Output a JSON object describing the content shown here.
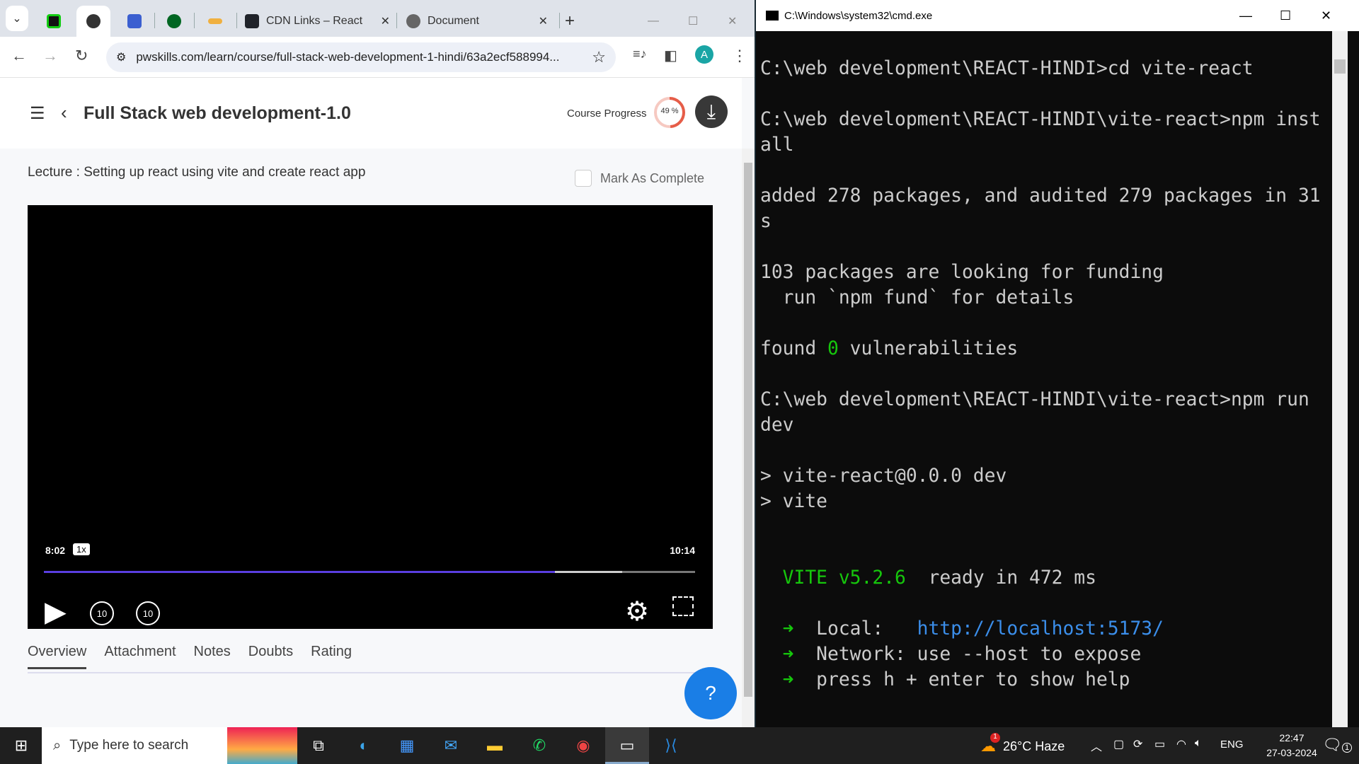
{
  "browser": {
    "tabs": [
      {
        "label": "CDN Links – React"
      },
      {
        "label": "Document"
      }
    ],
    "url": "pwskills.com/learn/course/full-stack-web-development-1-hindi/63a2ecf588994...",
    "profile_initial": "A"
  },
  "page": {
    "course_title": "Full Stack web development-1.0",
    "progress_label": "Course Progress",
    "progress_value": "49 %",
    "progress_fraction": 0.49,
    "lecture_title": "Lecture : Setting up react using vite and create react app",
    "mark_complete": "Mark As Complete",
    "video": {
      "current_time": "8:02",
      "speed": "1x",
      "duration": "10:14",
      "played_fraction": 0.785,
      "buffered_fraction": 0.888,
      "rewind_label": "10",
      "forward_label": "10"
    },
    "tabs": [
      {
        "label": "Overview",
        "active": true
      },
      {
        "label": "Attachment"
      },
      {
        "label": "Notes"
      },
      {
        "label": "Doubts"
      },
      {
        "label": "Rating"
      }
    ],
    "accent": "#5a3ee0"
  },
  "cmd": {
    "title": "C:\\Windows\\system32\\cmd.exe",
    "lines": [
      [
        {
          "t": "C:\\web development\\REACT-HINDI>cd vite-react"
        }
      ],
      [],
      [
        {
          "t": "C:\\web development\\REACT-HINDI\\vite-react>npm inst"
        }
      ],
      [
        {
          "t": "all"
        }
      ],
      [],
      [
        {
          "t": "added 278 packages, and audited 279 packages in 31"
        }
      ],
      [
        {
          "t": "s"
        }
      ],
      [],
      [
        {
          "t": "103 packages are looking for funding"
        }
      ],
      [
        {
          "t": "  run `npm fund` for details"
        }
      ],
      [],
      [
        {
          "t": "found "
        },
        {
          "t": "0",
          "c": "#16c60c"
        },
        {
          "t": " vulnerabilities"
        }
      ],
      [],
      [
        {
          "t": "C:\\web development\\REACT-HINDI\\vite-react>npm run"
        }
      ],
      [
        {
          "t": "dev"
        }
      ],
      [],
      [
        {
          "t": "> vite-react@0.0.0 dev"
        }
      ],
      [
        {
          "t": "> vite"
        }
      ],
      [],
      [],
      [
        {
          "t": "  VITE v5.2.6",
          "c": "#16c60c"
        },
        {
          "t": "  ready in 472 ms"
        }
      ],
      [],
      [
        {
          "t": "  ➜",
          "c": "#16c60c"
        },
        {
          "t": "  Local:   "
        },
        {
          "t": "http://localhost:5173/",
          "c": "#3b8eea"
        }
      ],
      [
        {
          "t": "  ➜",
          "c": "#16c60c"
        },
        {
          "t": "  Network: use --host to expose"
        }
      ],
      [
        {
          "t": "  ➜",
          "c": "#16c60c"
        },
        {
          "t": "  press h + enter to show help"
        }
      ]
    ]
  },
  "taskbar": {
    "search_placeholder": "Type here to search",
    "weather": "26°C  Haze",
    "weather_badge": "1",
    "language": "ENG",
    "time": "22:47",
    "date": "27-03-2024",
    "notification_count": "1"
  }
}
